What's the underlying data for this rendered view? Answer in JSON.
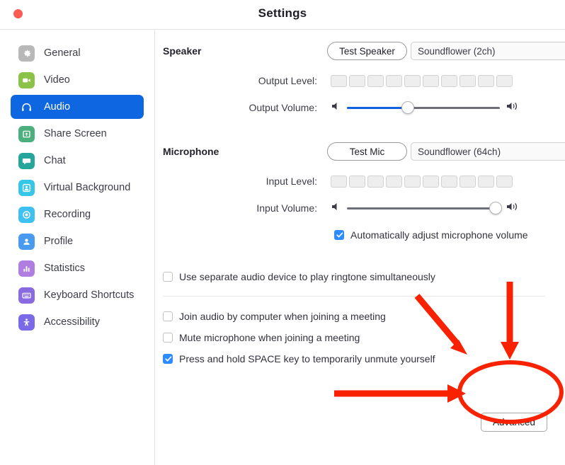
{
  "window": {
    "title": "Settings",
    "close_label": "Close"
  },
  "sidebar": {
    "items": [
      {
        "label": "General",
        "icon": "gear-icon",
        "color": "#b8b8b8",
        "selected": false
      },
      {
        "label": "Video",
        "icon": "video-camera-icon",
        "color": "#8bc34a",
        "selected": false
      },
      {
        "label": "Audio",
        "icon": "headphones-icon",
        "color": "#0e66e0",
        "selected": true
      },
      {
        "label": "Share Screen",
        "icon": "share-screen-icon",
        "color": "#4caf7d",
        "selected": false
      },
      {
        "label": "Chat",
        "icon": "chat-bubble-icon",
        "color": "#26a69a",
        "selected": false
      },
      {
        "label": "Virtual Background",
        "icon": "person-frame-icon",
        "color": "#35c6e8",
        "selected": false
      },
      {
        "label": "Recording",
        "icon": "record-circle-icon",
        "color": "#3ec0f0",
        "selected": false
      },
      {
        "label": "Profile",
        "icon": "person-icon",
        "color": "#4a9bf0",
        "selected": false
      },
      {
        "label": "Statistics",
        "icon": "bar-chart-icon",
        "color": "#b07de0",
        "selected": false
      },
      {
        "label": "Keyboard Shortcuts",
        "icon": "keyboard-icon",
        "color": "#8a6ae0",
        "selected": false
      },
      {
        "label": "Accessibility",
        "icon": "accessibility-icon",
        "color": "#7a6ae8",
        "selected": false
      }
    ]
  },
  "speaker": {
    "section_label": "Speaker",
    "test_button": "Test Speaker",
    "device": "Soundflower (2ch)",
    "output_level_label": "Output Level:",
    "output_level_segments": 10,
    "output_level_active": 0,
    "output_volume_label": "Output Volume:",
    "output_volume_percent": 40
  },
  "microphone": {
    "section_label": "Microphone",
    "test_button": "Test Mic",
    "device": "Soundflower (64ch)",
    "input_level_label": "Input Level:",
    "input_level_segments": 10,
    "input_level_active": 0,
    "input_volume_label": "Input Volume:",
    "input_volume_percent": 97,
    "auto_adjust_label": "Automatically adjust microphone volume",
    "auto_adjust_checked": true
  },
  "options": {
    "ringtone": {
      "label": "Use separate audio device to play ringtone simultaneously",
      "checked": false
    },
    "join_audio": {
      "label": "Join audio by computer when joining a meeting",
      "checked": false
    },
    "mute_mic": {
      "label": "Mute microphone when joining a meeting",
      "checked": false
    },
    "push_to_talk": {
      "label": "Press and hold SPACE key to temporarily unmute yourself",
      "checked": true
    }
  },
  "advanced": {
    "button_label": "Advanced"
  },
  "annotations": {
    "highlight_color": "#f92200",
    "ellipse_target": "Advanced",
    "arrows": [
      {
        "name": "diagonal-arrow",
        "direction": "down-right"
      },
      {
        "name": "vertical-arrow",
        "direction": "down"
      },
      {
        "name": "horizontal-arrow",
        "direction": "right"
      }
    ]
  }
}
